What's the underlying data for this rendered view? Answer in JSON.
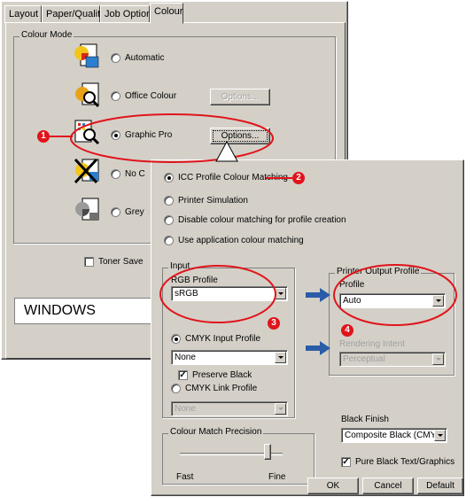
{
  "back_dialog": {
    "tabs": [
      "Layout",
      "Paper/Quality",
      "Job Options",
      "Colour"
    ],
    "group_label": "Colour Mode",
    "modes": [
      {
        "label": "Automatic",
        "selected": false,
        "button": null
      },
      {
        "label": "Office Colour",
        "selected": false,
        "button": "Options..."
      },
      {
        "label": "Graphic Pro",
        "selected": true,
        "button": "Options..."
      },
      {
        "label": "No C",
        "selected": false,
        "button": null
      },
      {
        "label": "Grey",
        "selected": false,
        "button": null
      }
    ],
    "toner_save_label": "Toner Save",
    "os_label": "WINDOWS"
  },
  "front_dialog": {
    "options": [
      {
        "label": "ICC Profile Colour Matching",
        "selected": true
      },
      {
        "label": "Printer Simulation",
        "selected": false
      },
      {
        "label": "Disable colour matching for profile creation",
        "selected": false
      },
      {
        "label": "Use application colour matching",
        "selected": false
      }
    ],
    "input_group": "Input",
    "rgb_profile_label": "RGB Profile",
    "rgb_profile_value": "sRGB",
    "cmyk_input_label": "CMYK Input Profile",
    "cmyk_input_value": "None",
    "preserve_black_label": "Preserve Black",
    "cmyk_link_label": "CMYK Link Profile",
    "cmyk_link_value": "None",
    "output_group": "Printer Output Profile",
    "profile_label": "Profile",
    "profile_value": "Auto",
    "rendering_intent_label": "Rendering Intent",
    "rendering_intent_value": "Perceptual",
    "precision_group": "Colour Match Precision",
    "precision_fast": "Fast",
    "precision_fine": "Fine",
    "precision_level": 0.85,
    "black_finish_label": "Black Finish",
    "black_finish_value": "Composite Black (CMYK)",
    "pure_black_label": "Pure Black Text/Graphics",
    "ok_label": "OK",
    "cancel_label": "Cancel",
    "default_label": "Default"
  },
  "callouts": [
    "1",
    "2",
    "3",
    "4"
  ],
  "colors": {
    "callout_red": "#e0141b",
    "arrow_blue": "#2a5ca8",
    "dialog_bg": "#d4d0c8"
  }
}
